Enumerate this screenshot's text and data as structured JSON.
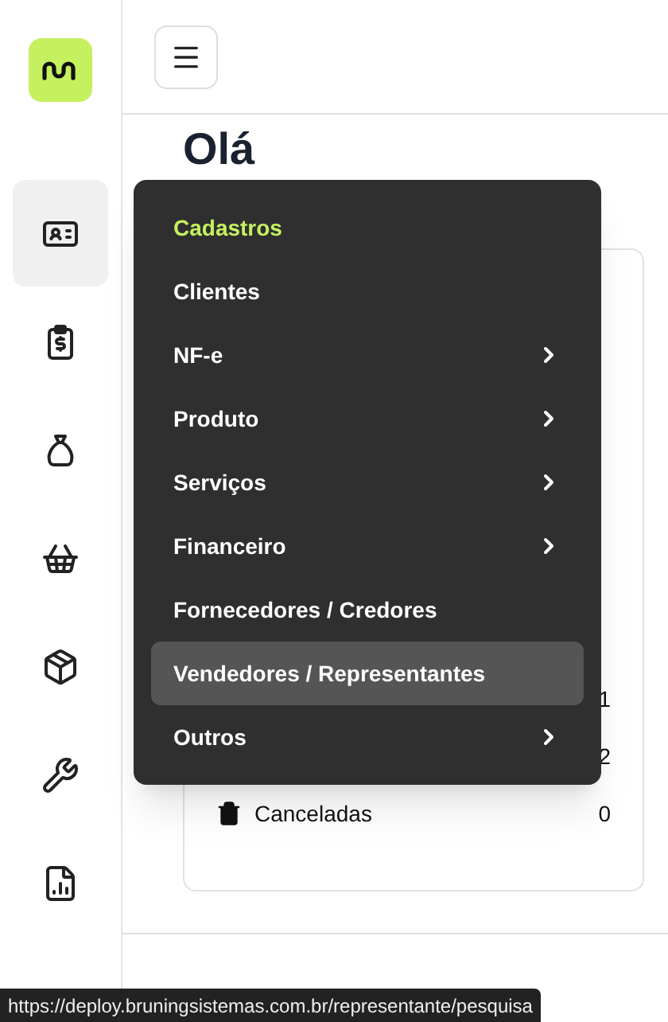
{
  "sidebar": {
    "items": [
      {
        "selected": true
      },
      {
        "selected": false
      },
      {
        "selected": false
      },
      {
        "selected": false
      },
      {
        "selected": false
      },
      {
        "selected": false
      },
      {
        "selected": false
      }
    ]
  },
  "greeting": "Olá",
  "summary": {
    "rows": [
      {
        "value": "1"
      },
      {
        "value": "2"
      },
      {
        "label": "Canceladas",
        "value": "0"
      }
    ]
  },
  "menu": {
    "title": "Cadastros",
    "items": [
      {
        "label": "Clientes",
        "submenu": false,
        "selected": false
      },
      {
        "label": "NF-e",
        "submenu": true,
        "selected": false
      },
      {
        "label": "Produto",
        "submenu": true,
        "selected": false
      },
      {
        "label": "Serviços",
        "submenu": true,
        "selected": false
      },
      {
        "label": "Financeiro",
        "submenu": true,
        "selected": false
      },
      {
        "label": "Fornecedores / Credores",
        "submenu": false,
        "selected": false
      },
      {
        "label": "Vendedores / Representantes",
        "submenu": false,
        "selected": true
      },
      {
        "label": "Outros",
        "submenu": true,
        "selected": false
      }
    ]
  },
  "status_url": "https://deploy.bruningsistemas.com.br/representante/pesquisa"
}
